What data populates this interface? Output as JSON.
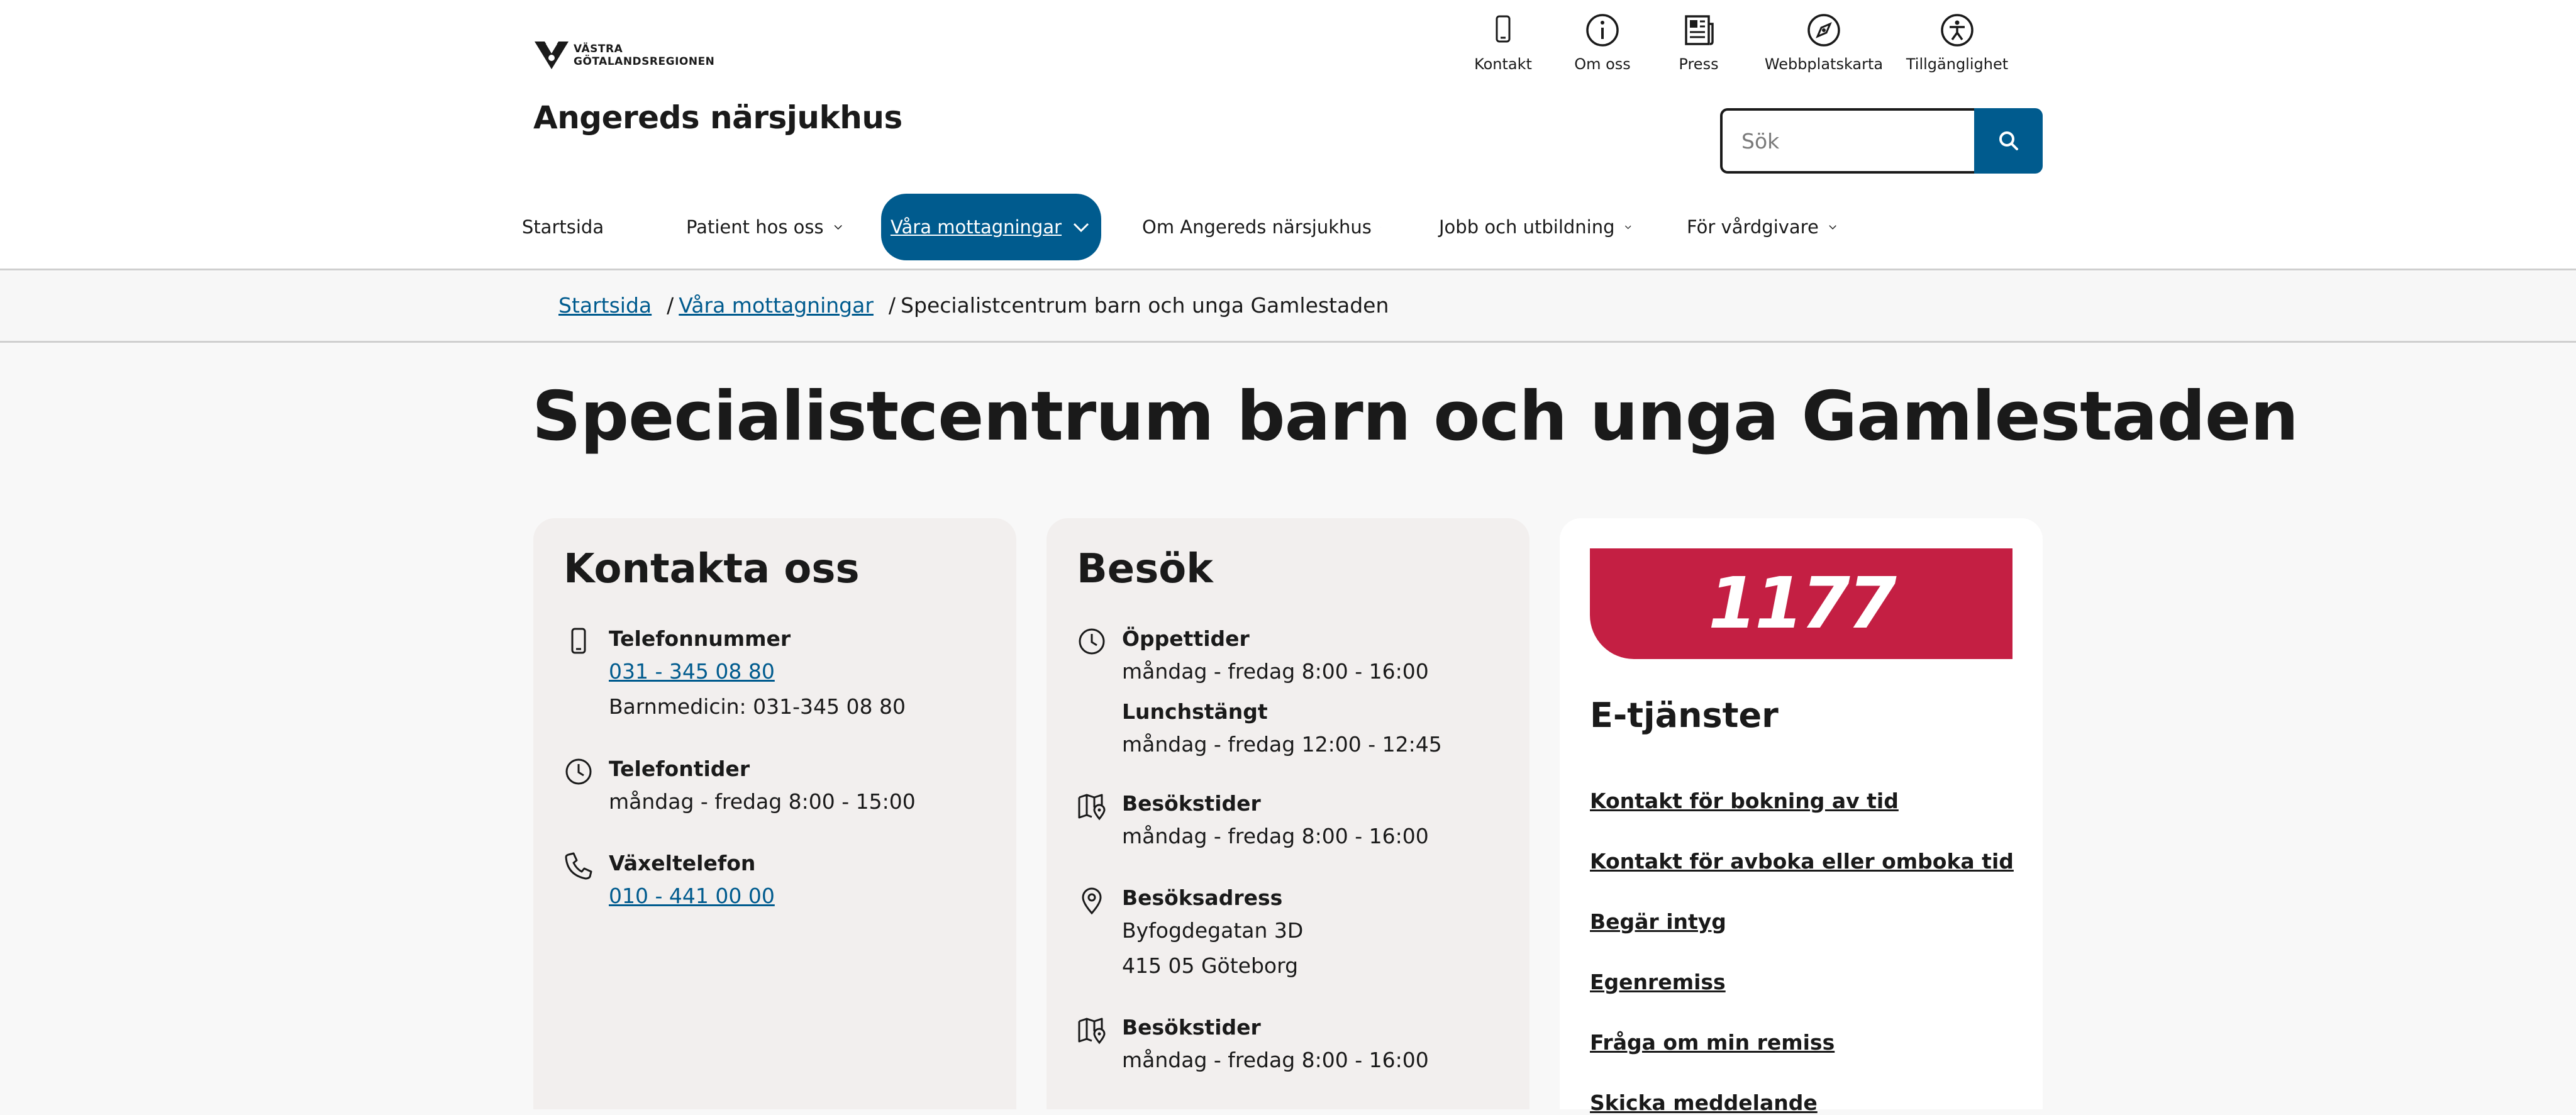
{
  "brand": {
    "logo_text_line1": "VÄSTRA",
    "logo_text_line2": "GÖTALANDSREGIONEN",
    "site_title": "Angereds närsjukhus"
  },
  "utility_nav": [
    {
      "label": "Kontakt",
      "icon": "phone-icon"
    },
    {
      "label": "Om oss",
      "icon": "info-icon"
    },
    {
      "label": "Press",
      "icon": "newspaper-icon"
    },
    {
      "label": "Webbplatskarta",
      "icon": "compass-icon"
    },
    {
      "label": "Tillgänglighet",
      "icon": "accessibility-icon"
    }
  ],
  "search": {
    "placeholder": "Sök",
    "value": ""
  },
  "main_nav": [
    {
      "label": "Startsida",
      "dropdown": false,
      "active": false
    },
    {
      "label": "Patient hos oss",
      "dropdown": true,
      "active": false
    },
    {
      "label": "Våra mottagningar",
      "dropdown": true,
      "active": true
    },
    {
      "label": "Om Angereds närsjukhus",
      "dropdown": true,
      "active": false
    },
    {
      "label": "Jobb och utbildning",
      "dropdown": true,
      "active": false
    },
    {
      "label": "För vårdgivare",
      "dropdown": true,
      "active": false
    }
  ],
  "breadcrumb": {
    "home": "Startsida",
    "section": "Våra mottagningar",
    "current": "Specialistcentrum barn och unga Gamlestaden",
    "separator": "/"
  },
  "page_title": "Specialistcentrum barn och unga Gamlestaden",
  "contact": {
    "title": "Kontakta oss",
    "phone_heading": "Telefonnummer",
    "phone_number": "031 - 345 08 80",
    "phone_note": "Barnmedicin: 031-345 08 80",
    "hours_heading": "Telefontider",
    "hours_text": "måndag - fredag 8:00 - 15:00",
    "switch_heading": "Växeltelefon",
    "switch_number": "010 - 441 00 00"
  },
  "visit": {
    "title": "Besök",
    "opening_heading": "Öppettider",
    "opening_text": "måndag - fredag 8:00 - 16:00",
    "lunch_heading": "Lunchstängt",
    "lunch_text": "måndag - fredag 12:00 - 12:45",
    "visiting_heading": "Besökstider",
    "visiting_text": "måndag - fredag 8:00 - 16:00",
    "address_heading": "Besöksadress",
    "address_line1": "Byfogdegatan 3D",
    "address_line2": "415 05 Göteborg",
    "visiting2_heading": "Besökstider",
    "visiting2_text": "måndag - fredag 8:00 - 16:00"
  },
  "eservices": {
    "logo_text": "1177",
    "title": "E-tjänster",
    "links": [
      "Kontakt för bokning av tid",
      "Kontakt för avboka eller omboka tid",
      "Begär intyg",
      "Egenremiss",
      "Fråga om min remiss",
      "Skicka meddelande"
    ]
  },
  "colors": {
    "primary": "#005b8e",
    "brand_1177": "#c41f43",
    "card_grey": "#f2efee",
    "page_bg": "#f8f8f8"
  }
}
